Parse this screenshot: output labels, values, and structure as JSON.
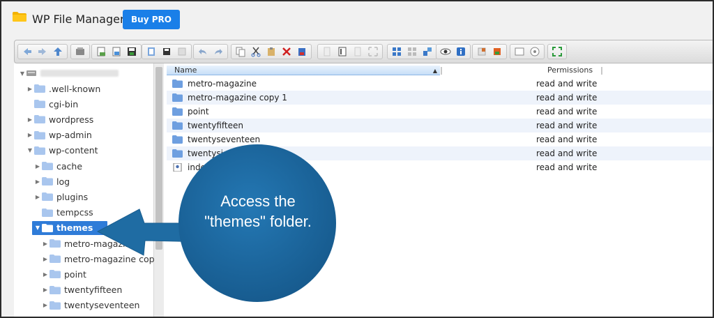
{
  "header": {
    "title": "WP File Manager",
    "buy_label": "Buy PRO"
  },
  "toolbar": {
    "icons": [
      "back-icon",
      "forward-icon",
      "up-icon",
      "reload-icon",
      "home-icon",
      "new-folder-icon",
      "save-icon",
      "open-icon",
      "floppy-icon",
      "download-icon",
      "undo-icon",
      "redo-icon",
      "copy-icon",
      "cut-icon",
      "paste-icon",
      "delete-icon",
      "empty-icon",
      "duplicate-icon",
      "rename-icon",
      "edit-icon",
      "resize-icon",
      "extract-icon",
      "archive-icon",
      "view-icons-icon",
      "view-list-icon",
      "sort-icon",
      "preview-icon",
      "info-icon",
      "select-all-icon",
      "select-none-icon",
      "fullscreen-icon",
      "help-icon",
      "settings-icon"
    ]
  },
  "tree": {
    "root_label": "",
    "items": [
      {
        "label": ".well-known",
        "expandable": true
      },
      {
        "label": "cgi-bin",
        "expandable": false
      },
      {
        "label": "wordpress",
        "expandable": true
      },
      {
        "label": "wp-admin",
        "expandable": true
      },
      {
        "label": "wp-content",
        "expandable": true,
        "expanded": true
      },
      {
        "label": "cache",
        "expandable": true
      },
      {
        "label": "log",
        "expandable": true
      },
      {
        "label": "plugins",
        "expandable": true
      },
      {
        "label": "tempcss",
        "expandable": false
      },
      {
        "label": "themes",
        "expandable": true,
        "expanded": true,
        "selected": true
      },
      {
        "label": "metro-magazine",
        "expandable": true
      },
      {
        "label": "metro-magazine copy",
        "expandable": true
      },
      {
        "label": "point",
        "expandable": true
      },
      {
        "label": "twentyfifteen",
        "expandable": true
      },
      {
        "label": "twentyseventeen",
        "expandable": true
      }
    ]
  },
  "list": {
    "columns": {
      "name": "Name",
      "permissions": "Permissions"
    },
    "rows": [
      {
        "name": "metro-magazine",
        "permissions": "read and write",
        "type": "folder"
      },
      {
        "name": "metro-magazine copy 1",
        "permissions": "read and write",
        "type": "folder"
      },
      {
        "name": "point",
        "permissions": "read and write",
        "type": "folder"
      },
      {
        "name": "twentyfifteen",
        "permissions": "read and write",
        "type": "folder"
      },
      {
        "name": "twentyseventeen",
        "permissions": "read and write",
        "type": "folder"
      },
      {
        "name": "twentysi",
        "permissions": "read and write",
        "type": "folder"
      },
      {
        "name": "inde",
        "permissions": "read and write",
        "type": "file"
      }
    ]
  },
  "callout": {
    "line1": "Access the",
    "line2": "\"themes\" folder."
  },
  "colors": {
    "accent": "#1a7fe8",
    "selection": "#2f7cd8",
    "callout": "#1f6ca3",
    "folder": "#6e9fe0"
  }
}
